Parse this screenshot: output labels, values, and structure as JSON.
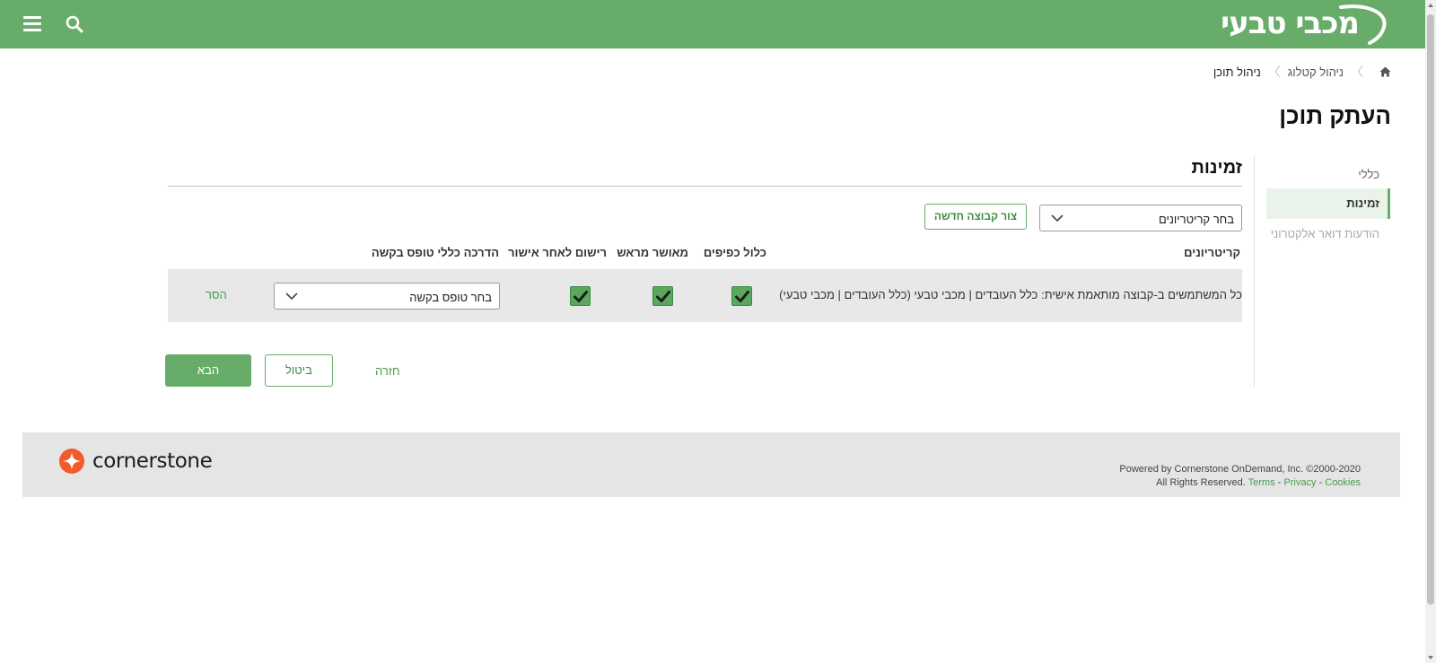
{
  "header": {
    "menu_icon": "hamburger-menu-icon",
    "search_icon": "search-icon",
    "logo_text": "מכבי טבעי",
    "brand_color": "#67ad69"
  },
  "breadcrumb": {
    "home_icon": "home-icon",
    "items": [
      "ניהול קטלוג",
      "ניהול תוכן"
    ]
  },
  "page_title": "העתק תוכן",
  "sidenav": {
    "items": [
      "כללי",
      "זמינות",
      "הודעות דואר אלקטרוני"
    ],
    "active": "זמינות"
  },
  "section": {
    "title": "זמינות",
    "criteria_select": "בחר קריטריונים",
    "new_group_button": "צור קבוצה חדשה"
  },
  "table": {
    "headers": {
      "criteria": "קריטריונים",
      "include_subs": "כלול כפיפים",
      "pre_approved": "מאושר מראש",
      "register_after": "רישום לאחר אישור",
      "guide_form": "הדרכה כללי טופס בקשה"
    },
    "rows": [
      {
        "criteria": "כל המשתמשים ב-קבוצה מותאמת אישית: כלל העובדים | מכבי טבעי (כלל העובדים | מכבי טבעי)",
        "include_subs": true,
        "pre_approved": true,
        "register_after": true,
        "form_select": "בחר טופס בקשה",
        "remove": "הסר"
      }
    ]
  },
  "actions": {
    "next": "הבא",
    "cancel": "ביטול",
    "back": "חזרה"
  },
  "footer": {
    "logo_word": "cornerstone",
    "logo_color": "#f15a29",
    "powered": "Powered by Cornerstone OnDemand, Inc. ©2000-2020",
    "rights": "All Rights Reserved.",
    "terms": "Terms",
    "privacy": "Privacy",
    "cookies": "Cookies",
    "dash": "-"
  }
}
